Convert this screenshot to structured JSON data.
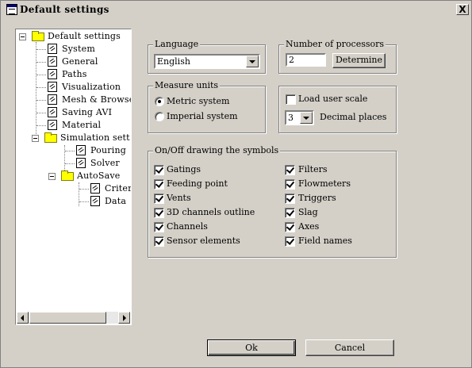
{
  "window": {
    "title": "Default settings",
    "close_label": "X"
  },
  "tree": {
    "items": [
      {
        "label": "Default settings"
      },
      {
        "label": "System"
      },
      {
        "label": "General"
      },
      {
        "label": "Paths"
      },
      {
        "label": "Visualization"
      },
      {
        "label": "Mesh & Browser"
      },
      {
        "label": "Saving AVI"
      },
      {
        "label": "Material"
      },
      {
        "label": "Simulation sett"
      },
      {
        "label": "Pouring"
      },
      {
        "label": "Solver"
      },
      {
        "label": "AutoSave"
      },
      {
        "label": "Criteria"
      },
      {
        "label": "Data"
      }
    ]
  },
  "language": {
    "group_label": "Language",
    "value": "English"
  },
  "processors": {
    "group_label": "Number of processors",
    "value": "2",
    "determine_label": "Determine"
  },
  "units": {
    "group_label": "Measure units",
    "options": [
      {
        "label": "Metric system",
        "selected": true
      },
      {
        "label": "Imperial system",
        "selected": false
      }
    ]
  },
  "scale": {
    "load_label": "Load user scale",
    "load_checked": false,
    "decimal_value": "3",
    "decimal_label": "Decimal places"
  },
  "symbols": {
    "group_label": "On/Off drawing the symbols",
    "left": [
      {
        "label": "Gatings",
        "checked": true
      },
      {
        "label": "Feeding point",
        "checked": true
      },
      {
        "label": "Vents",
        "checked": true
      },
      {
        "label": "3D channels outline",
        "checked": true
      },
      {
        "label": "Channels",
        "checked": true
      },
      {
        "label": "Sensor elements",
        "checked": true
      }
    ],
    "right": [
      {
        "label": "Filters",
        "checked": true
      },
      {
        "label": "Flowmeters",
        "checked": true
      },
      {
        "label": "Triggers",
        "checked": true
      },
      {
        "label": "Slag",
        "checked": true
      },
      {
        "label": "Axes",
        "checked": true
      },
      {
        "label": "Field names",
        "checked": true
      }
    ]
  },
  "buttons": {
    "ok_label": "Ok",
    "cancel_label": "Cancel"
  }
}
